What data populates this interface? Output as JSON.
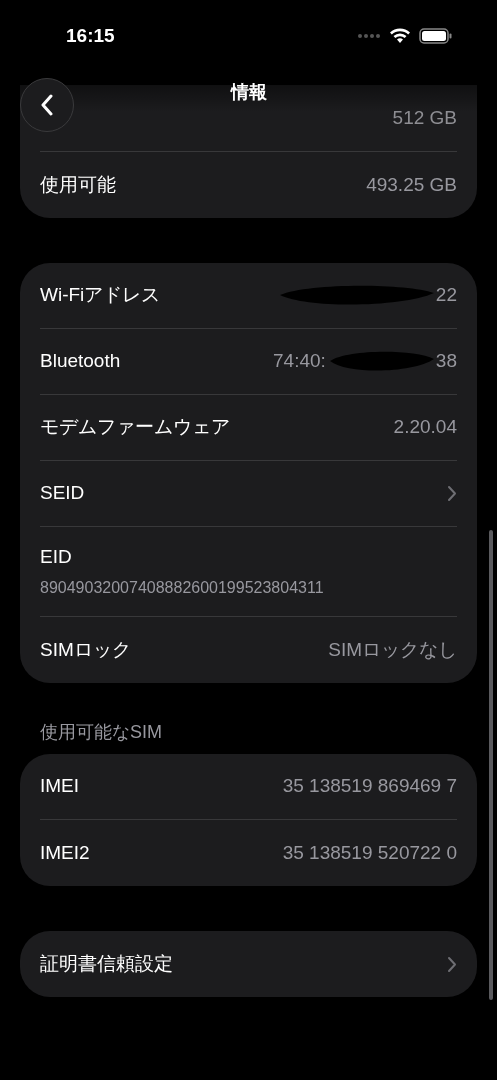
{
  "status_bar": {
    "time": "16:15"
  },
  "nav": {
    "title": "情報"
  },
  "groups": [
    {
      "rows": [
        {
          "kind": "blurred",
          "value": "512 GB"
        },
        {
          "kind": "value",
          "label": "使用可能",
          "value": "493.25 GB"
        }
      ]
    },
    {
      "rows": [
        {
          "kind": "redacted",
          "label": "Wi-Fiアドレス",
          "value_tail": "22"
        },
        {
          "kind": "redacted",
          "label": "Bluetooth",
          "value_head": "74:40:",
          "value_tail": "38"
        },
        {
          "kind": "value",
          "label": "モデムファームウェア",
          "value": "2.20.04"
        },
        {
          "kind": "link",
          "label": "SEID"
        },
        {
          "kind": "stacked",
          "label": "EID",
          "value": "89049032007408882600199523804311"
        },
        {
          "kind": "value",
          "label": "SIMロック",
          "value": "SIMロックなし"
        }
      ]
    },
    {
      "header": "使用可能なSIM",
      "rows": [
        {
          "kind": "value",
          "label": "IMEI",
          "value": "35 138519 869469 7"
        },
        {
          "kind": "value",
          "label": "IMEI2",
          "value": "35 138519 520722 0"
        }
      ]
    },
    {
      "rows": [
        {
          "kind": "link",
          "label": "証明書信頼設定"
        }
      ]
    }
  ]
}
